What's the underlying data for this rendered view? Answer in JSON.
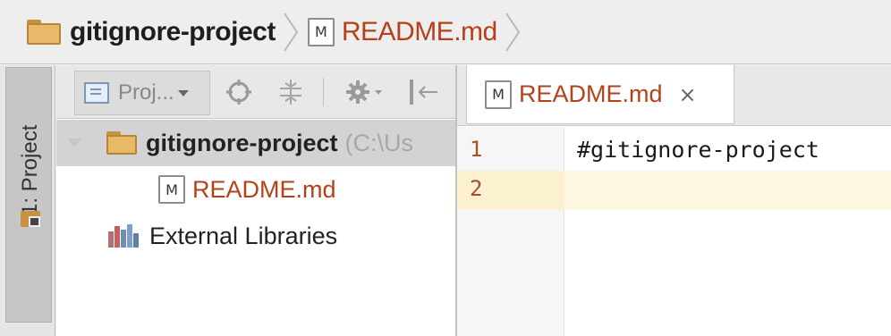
{
  "breadcrumb": {
    "project": "gitignore-project",
    "file": "README.md",
    "file_icon_letter": "M"
  },
  "tool_window_tab": {
    "label": "1: Project"
  },
  "project_panel": {
    "view_selector": "Proj...",
    "toolbar_icons": [
      "locate-icon",
      "collapse-all-icon",
      "gear-icon",
      "hide-panel-icon"
    ],
    "tree": [
      {
        "label": "gitignore-project",
        "path": "(C:\\Us",
        "type": "folder",
        "expanded": true,
        "selected": true
      },
      {
        "label": "README.md",
        "type": "md-file",
        "icon_letter": "M"
      },
      {
        "label": "External Libraries",
        "type": "libraries"
      }
    ]
  },
  "editor": {
    "tab_title": "README.md",
    "tab_icon_letter": "M",
    "close_glyph": "×",
    "lines": [
      {
        "number": "1",
        "text": "#gitignore-project"
      },
      {
        "number": "2",
        "text": ""
      }
    ],
    "current_line": 2
  },
  "colors": {
    "md_text": "#b5411a",
    "folder": "#e9b96a",
    "current_line": "#fdf7e2"
  }
}
